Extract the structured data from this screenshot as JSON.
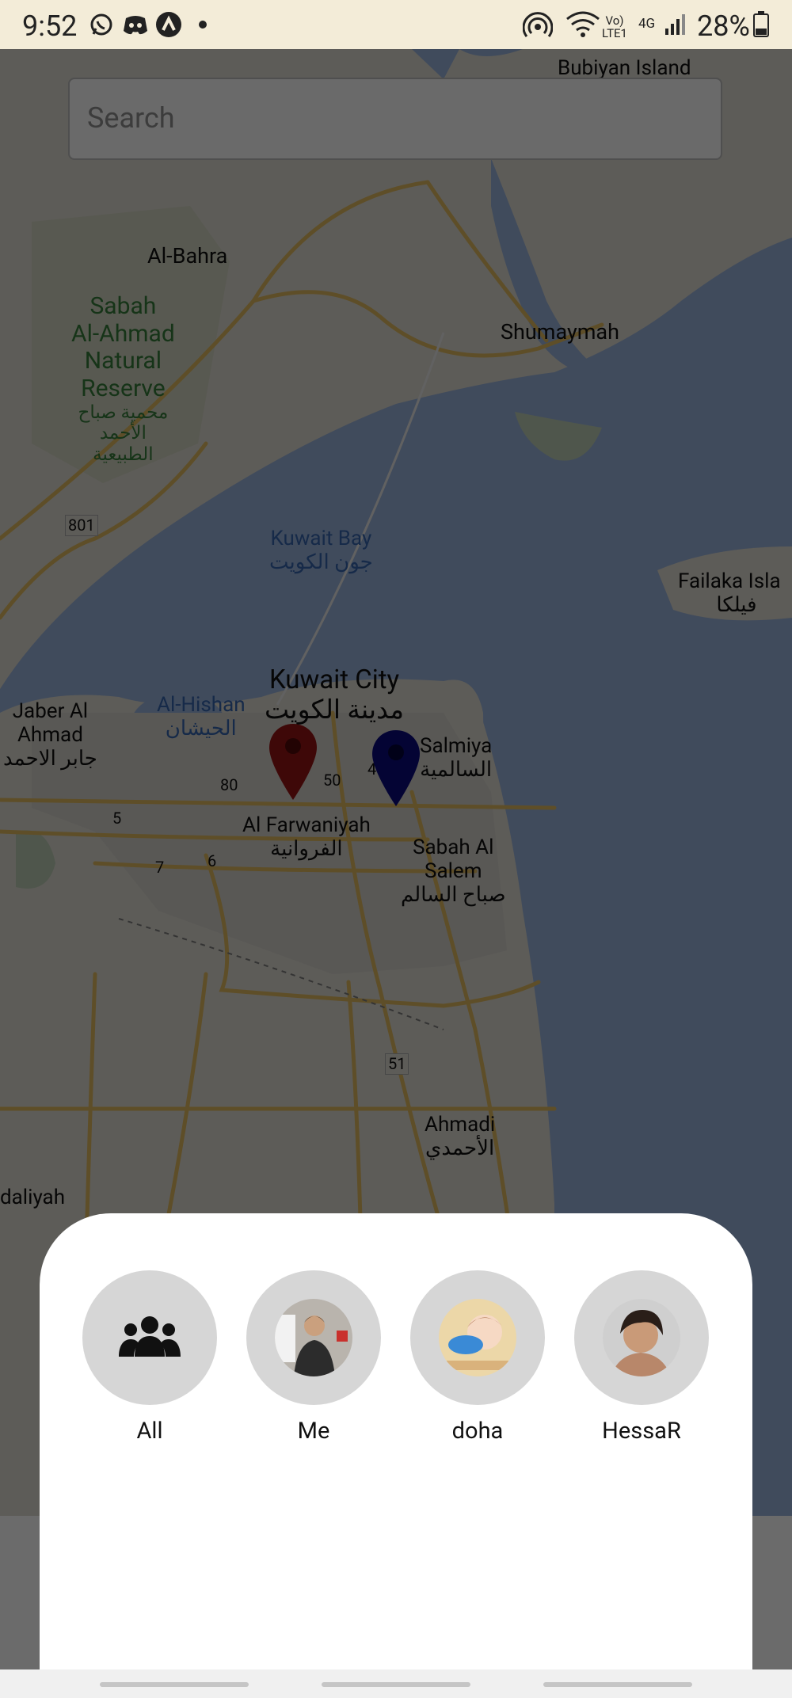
{
  "status_bar": {
    "time": "9:52",
    "network_top": "Vo)",
    "network_bottom": "LTE1",
    "network_gen": "4G",
    "battery": "28%",
    "icons": [
      "whatsapp-icon",
      "discord-icon",
      "app-a-icon",
      "dot-icon",
      "hotspot-icon",
      "wifi-icon",
      "signal-icon",
      "battery-icon"
    ]
  },
  "search": {
    "placeholder": "Search"
  },
  "map": {
    "places": {
      "bubiyan": "Bubiyan Island",
      "al_bahra": "Al-Bahra",
      "sabah_reserve": [
        "Sabah",
        "Al-Ahmad",
        "Natural",
        "Reserve"
      ],
      "sabah_reserve_ar": [
        "محمية صباح",
        "الأحمد",
        "الطبيعية"
      ],
      "shumaymah": "Shumaymah",
      "route_801": "801",
      "kuwait_bay": "Kuwait Bay",
      "kuwait_bay_ar": "جون الكويت",
      "failaka": "Failaka Isla",
      "failaka_ar": "فيلكا",
      "kuwait_city": "Kuwait City",
      "kuwait_city_ar": "مدينة الكويت",
      "jaber": [
        "Jaber Al",
        "Ahmad"
      ],
      "jaber_ar": "جابر الاحمد",
      "al_hishan": "Al-Hishan",
      "al_hishan_ar": "الحيشان",
      "salmiya": "Salmiya",
      "salmiya_ar": "السالمية",
      "route_80": "80",
      "route_50": "50",
      "route_40": "4",
      "route_5": "5",
      "route_7": "7",
      "route_6": "6",
      "farwaniyah": "Al Farwaniyah",
      "farwaniyah_ar": "الفروانية",
      "sabah_salem": [
        "Sabah Al",
        "Salem"
      ],
      "sabah_salem_ar": "صباح السالم",
      "route_51": "51",
      "ahmadi": "Ahmadi",
      "ahmadi_ar": "الأحمدي",
      "daliyah": "daliyah"
    },
    "markers": [
      {
        "name": "red-marker",
        "color": "#a31515"
      },
      {
        "name": "blue-marker",
        "color": "#0d0d8a"
      }
    ]
  },
  "contacts": [
    {
      "label": "All",
      "icon": "group-icon"
    },
    {
      "label": "Me",
      "icon": "avatar"
    },
    {
      "label": "doha",
      "icon": "avatar"
    },
    {
      "label": "HessaR",
      "icon": "avatar"
    }
  ],
  "colors": {
    "land": "#f5f1e6",
    "water": "#a9c4f1",
    "road": "#f7ce6b",
    "sheet": "#ffffff",
    "avatar_ring": "#d6d6d6"
  }
}
